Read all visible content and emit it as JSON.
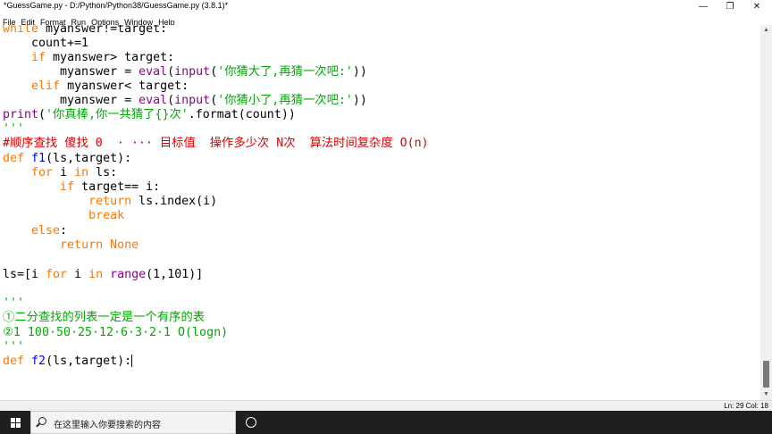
{
  "window": {
    "title": "*GuessGame.py - D:/Python/Python38/GuessGame.py (3.8.1)*",
    "minimize_glyph": "—",
    "restore_glyph": "❐",
    "close_glyph": "✕"
  },
  "menu": [
    "File",
    "Edit",
    "Format",
    "Run",
    "Options",
    "Window",
    "Help"
  ],
  "code": {
    "l1": {
      "a": "while",
      "b": " myanswer!=target:"
    },
    "l2": {
      "a": "    count+=1"
    },
    "l3": {
      "a": "    ",
      "b": "if",
      "c": " myanswer> target:"
    },
    "l4": {
      "a": "        myanswer = ",
      "b": "eval",
      "c": "(",
      "d": "input",
      "e": "(",
      "f": "'你猜大了,再猜一次吧:'",
      "g": "))"
    },
    "l5": {
      "a": "    ",
      "b": "elif",
      "c": " myanswer< target:"
    },
    "l6": {
      "a": "        myanswer = ",
      "b": "eval",
      "c": "(",
      "d": "input",
      "e": "(",
      "f": "'你猜小了,再猜一次吧:'",
      "g": "))"
    },
    "l7": {
      "a": "print",
      "b": "(",
      "c": "'你真棒,你一共猜了{}次'",
      "d": ".format(count))"
    },
    "l8": {
      "a": "'''"
    },
    "l9": {
      "a": "#顺序查找 傻找 0  · ··· 目标值  操作多少次 N次  算法时间复杂度 O(n)"
    },
    "l10": {
      "a": "def",
      "b": " ",
      "c": "f1",
      "d": "(ls,target):"
    },
    "l11": {
      "a": "    ",
      "b": "for",
      "c": " i ",
      "d": "in",
      "e": " ls:"
    },
    "l12": {
      "a": "        ",
      "b": "if",
      "c": " target== i:"
    },
    "l13": {
      "a": "            ",
      "b": "return",
      "c": " ls.index(i)"
    },
    "l14": {
      "a": "            ",
      "b": "break"
    },
    "l15": {
      "a": "    ",
      "b": "else",
      "c": ":"
    },
    "l16": {
      "a": "        ",
      "b": "return",
      "c": " ",
      "d": "None"
    },
    "l17": {
      "a": "ls=[i ",
      "b": "for",
      "c": " i ",
      "d": "in",
      "e": " ",
      "f": "range",
      "g": "(1,101)]"
    },
    "l18": {
      "a": "'''"
    },
    "l19": {
      "a": "①二分查找的列表一定是一个有序的表"
    },
    "l20": {
      "a": "②1 100·50·25·12·6·3·2·1 O(logn)"
    },
    "l21": {
      "a": "'''"
    },
    "l22": {
      "a": "def",
      "b": " ",
      "c": "f2",
      "d": "(ls,target):"
    }
  },
  "status": {
    "position": "Ln: 29  Col: 18"
  },
  "taskbar": {
    "search_placeholder": "在这里输入你要搜索的内容"
  },
  "colors": {
    "keyword": "#ff7700",
    "builtin": "#900090",
    "string": "#00aa00",
    "comment": "#dd0000",
    "definition": "#0000ff",
    "taskbar": "#1f1f1f"
  }
}
